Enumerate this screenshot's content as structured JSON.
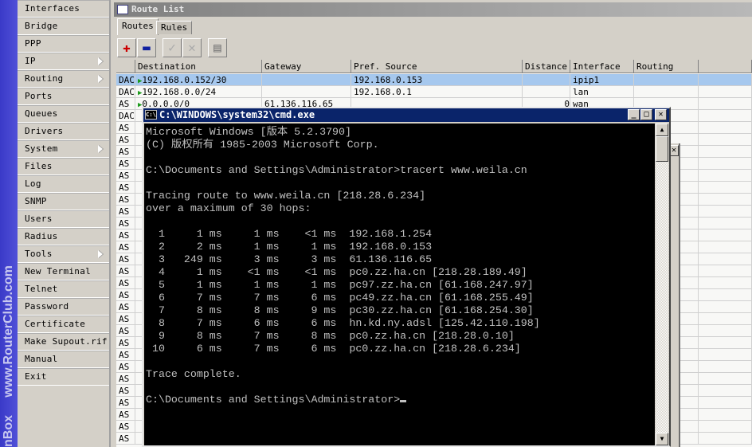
{
  "watermark": "www.RouterClub.com",
  "app_partial": "nBox",
  "menu": [
    {
      "label": "Interfaces",
      "sub": false
    },
    {
      "label": "Bridge",
      "sub": false
    },
    {
      "label": "PPP",
      "sub": false
    },
    {
      "label": "IP",
      "sub": true
    },
    {
      "label": "Routing",
      "sub": true
    },
    {
      "label": "Ports",
      "sub": false
    },
    {
      "label": "Queues",
      "sub": false
    },
    {
      "label": "Drivers",
      "sub": false
    },
    {
      "label": "System",
      "sub": true
    },
    {
      "label": "Files",
      "sub": false
    },
    {
      "label": "Log",
      "sub": false
    },
    {
      "label": "SNMP",
      "sub": false
    },
    {
      "label": "Users",
      "sub": false
    },
    {
      "label": "Radius",
      "sub": false
    },
    {
      "label": "Tools",
      "sub": true
    },
    {
      "label": "New Terminal",
      "sub": false
    },
    {
      "label": "Telnet",
      "sub": false
    },
    {
      "label": "Password",
      "sub": false
    },
    {
      "label": "Certificate",
      "sub": false
    },
    {
      "label": "Make Supout.rif",
      "sub": false
    },
    {
      "label": "Manual",
      "sub": false
    },
    {
      "label": "Exit",
      "sub": false
    }
  ],
  "route_list": {
    "title": "Route List",
    "tabs": [
      "Routes",
      "Rules"
    ],
    "toolbar": [
      {
        "icon": "plus-icon",
        "glyph": "✚"
      },
      {
        "icon": "minus-icon",
        "glyph": "▬"
      },
      {
        "icon": "check-icon",
        "glyph": "✓"
      },
      {
        "icon": "cross-icon",
        "glyph": "✕"
      },
      {
        "icon": "comment-icon",
        "glyph": "▤"
      }
    ],
    "columns": [
      "",
      "Destination",
      "Gateway",
      "Pref. Source",
      "Distance",
      "Interface",
      "Routing Mark"
    ],
    "rows": [
      {
        "flags": "DAC",
        "destination": "192.168.0.152/30",
        "gateway": "",
        "pref_source": "192.168.0.153",
        "distance": "",
        "interface": "ipip1",
        "mark": "",
        "selected": true
      },
      {
        "flags": "DAC",
        "destination": "192.168.0.0/24",
        "gateway": "",
        "pref_source": "192.168.0.1",
        "distance": "",
        "interface": "lan",
        "mark": ""
      },
      {
        "flags": "AS",
        "destination": "0.0.0.0/0",
        "gateway": "61.136.116.65",
        "pref_source": "",
        "distance": "0",
        "interface": "wan",
        "mark": ""
      },
      {
        "flags": "DAC"
      },
      {
        "flags": "AS"
      },
      {
        "flags": "AS"
      },
      {
        "flags": "AS"
      },
      {
        "flags": "AS"
      },
      {
        "flags": "AS"
      },
      {
        "flags": "AS"
      },
      {
        "flags": "AS"
      },
      {
        "flags": "AS"
      },
      {
        "flags": "AS"
      },
      {
        "flags": "AS"
      },
      {
        "flags": "AS"
      },
      {
        "flags": "AS"
      },
      {
        "flags": "AS"
      },
      {
        "flags": "AS"
      },
      {
        "flags": "AS"
      },
      {
        "flags": "AS"
      },
      {
        "flags": "AS"
      },
      {
        "flags": "AS"
      },
      {
        "flags": "AS"
      },
      {
        "flags": "AS"
      },
      {
        "flags": "AS"
      },
      {
        "flags": "AS"
      },
      {
        "flags": "AS"
      },
      {
        "flags": "AS"
      },
      {
        "flags": "AS"
      },
      {
        "flags": "AS"
      },
      {
        "flags": "AS"
      }
    ]
  },
  "cmd": {
    "title": "C:\\WINDOWS\\system32\\cmd.exe",
    "icon_text": "C:\\",
    "lines": [
      "Microsoft Windows [版本 5.2.3790]",
      "(C) 版权所有 1985-2003 Microsoft Corp.",
      "",
      "C:\\Documents and Settings\\Administrator>tracert www.weila.cn",
      "",
      "Tracing route to www.weila.cn [218.28.6.234]",
      "over a maximum of 30 hops:",
      "",
      "  1     1 ms     1 ms    <1 ms  192.168.1.254",
      "  2     2 ms     1 ms     1 ms  192.168.0.153",
      "  3   249 ms     3 ms     3 ms  61.136.116.65",
      "  4     1 ms    <1 ms    <1 ms  pc0.zz.ha.cn [218.28.189.49]",
      "  5     1 ms     1 ms     1 ms  pc97.zz.ha.cn [61.168.247.97]",
      "  6     7 ms     7 ms     6 ms  pc49.zz.ha.cn [61.168.255.49]",
      "  7     8 ms     8 ms     9 ms  pc30.zz.ha.cn [61.168.254.30]",
      "  8     7 ms     6 ms     6 ms  hn.kd.ny.adsl [125.42.110.198]",
      "  9     8 ms     7 ms     8 ms  pc0.zz.ha.cn [218.28.0.10]",
      " 10     6 ms     7 ms     6 ms  pc0.zz.ha.cn [218.28.6.234]",
      "",
      "Trace complete.",
      "",
      "C:\\Documents and Settings\\Administrator>"
    ]
  }
}
